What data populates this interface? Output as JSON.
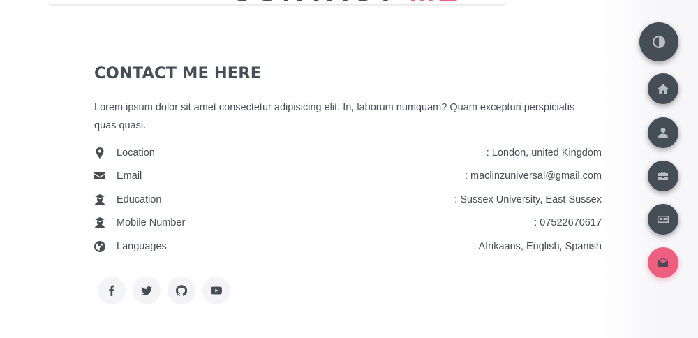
{
  "header": {
    "partial_heading_1": "CONTACT",
    "partial_heading_2": "ME"
  },
  "contact": {
    "title": "CONTACT ME HERE",
    "description": "Lorem ipsum dolor sit amet consectetur adipisicing elit. In, laborum numquam? Quam excepturi perspiciatis quas quasi.",
    "info": [
      {
        "icon": "map-marker-icon",
        "label": "Location",
        "value": ": London, united Kingdom"
      },
      {
        "icon": "envelope-icon",
        "label": "Email",
        "value": ": maclinzuniversal@gmail.com"
      },
      {
        "icon": "graduate-icon",
        "label": "Education",
        "value": ": Sussex University, East Sussex"
      },
      {
        "icon": "graduate-icon",
        "label": "Mobile Number",
        "value": ": 07522670617"
      },
      {
        "icon": "globe-icon",
        "label": "Languages",
        "value": ": Afrikaans, English, Spanish"
      }
    ]
  },
  "social": [
    "facebook-icon",
    "twitter-icon",
    "github-icon",
    "youtube-icon"
  ],
  "floating_nav": {
    "theme_toggle": "contrast-icon",
    "items": [
      "home-icon",
      "user-icon",
      "briefcase-icon",
      "newspaper-icon",
      "envelope-open-icon"
    ],
    "active_index": 4
  },
  "colors": {
    "text": "#454e56",
    "accent": "#ee5e7e",
    "fab_background": "#454e56",
    "social_background": "#f4f4f6"
  }
}
